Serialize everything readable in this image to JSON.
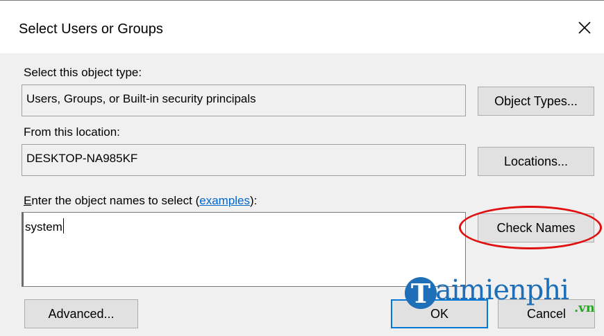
{
  "window": {
    "title": "Select Users or Groups"
  },
  "object_type": {
    "label": "Select this object type:",
    "value": "Users, Groups, or Built-in security principals",
    "button": "Object Types..."
  },
  "location": {
    "label": "From this location:",
    "value": "DESKTOP-NA985KF",
    "button": "Locations..."
  },
  "names": {
    "label_first": "E",
    "label_rest": "nter the object names to select (",
    "link": "examples",
    "label_end": "):",
    "value": "system",
    "check_button": "Check Names"
  },
  "footer": {
    "advanced_button": "Advanced...",
    "ok_button": "OK",
    "cancel_button": "Cancel"
  },
  "watermark": {
    "logo_letter": "T",
    "text": "aimienphi",
    "suffix": ".vn"
  },
  "colors": {
    "accent": "#0078d7",
    "highlight": "#e01010",
    "link": "#0066cc"
  }
}
